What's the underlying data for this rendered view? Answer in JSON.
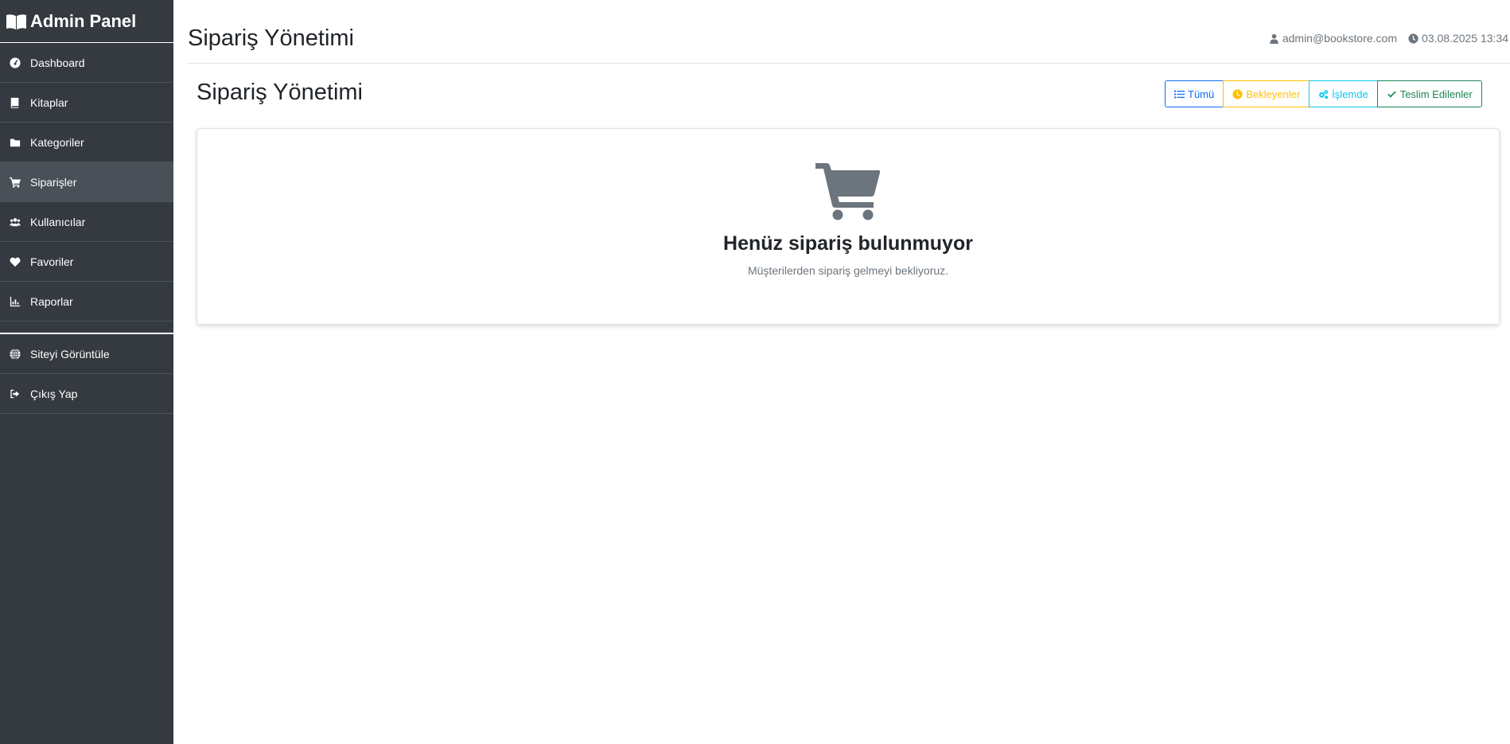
{
  "sidebar": {
    "brand": "Admin Panel",
    "items": [
      {
        "label": "Dashboard",
        "icon": "gauge-icon"
      },
      {
        "label": "Kitaplar",
        "icon": "book-icon"
      },
      {
        "label": "Kategoriler",
        "icon": "folder-icon"
      },
      {
        "label": "Siparişler",
        "icon": "cart-icon",
        "active": true
      },
      {
        "label": "Kullanıcılar",
        "icon": "users-icon"
      },
      {
        "label": "Favoriler",
        "icon": "heart-icon"
      },
      {
        "label": "Raporlar",
        "icon": "chart-icon"
      }
    ],
    "footer_items": [
      {
        "label": "Siteyi Görüntüle",
        "icon": "globe-icon"
      },
      {
        "label": "Çıkış Yap",
        "icon": "sign-out-icon"
      }
    ]
  },
  "header": {
    "title": "Sipariş Yönetimi",
    "user_email": "admin@bookstore.com",
    "datetime": "03.08.2025 13:34"
  },
  "main": {
    "title": "Sipariş Yönetimi",
    "filters": {
      "all": "Tümü",
      "pending": "Bekleyenler",
      "processing": "İşlemde",
      "delivered": "Teslim Edilenler"
    },
    "empty_state": {
      "title": "Henüz sipariş bulunmuyor",
      "subtitle": "Müşterilerden sipariş gelmeyi bekliyoruz."
    }
  },
  "colors": {
    "sidebar_bg": "#343a40",
    "sidebar_active": "#495057",
    "primary": "#0d6efd",
    "warning": "#ffc107",
    "info": "#0dcaf0",
    "success": "#198754",
    "muted": "#6c757d"
  }
}
